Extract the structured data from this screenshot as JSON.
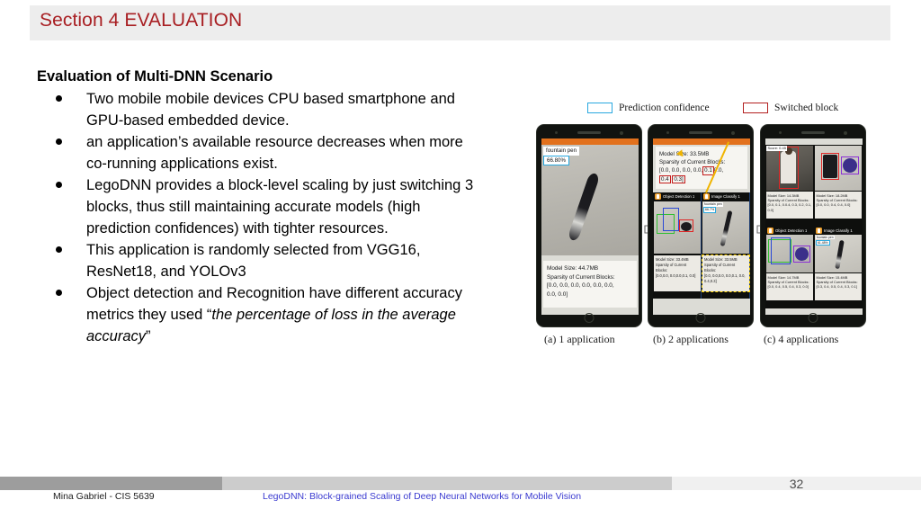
{
  "header": {
    "section_title": "Section 4 EVALUATION",
    "title_color": "#a81e22",
    "bar_color": "#ededed"
  },
  "content": {
    "heading": "Evaluation of Multi-DNN Scenario",
    "bullets": [
      {
        "text": "Two mobile mobile devices CPU based smartphone and GPU-based embedded device."
      },
      {
        "text": "an application’s available resource decreases when more co-running applications exist."
      },
      {
        "text": "LegoDNN provides a block-level scaling by just switching 3 blocks, thus still maintaining accurate models (high prediction confidences) with tighter resources."
      },
      {
        "text": "This application is randomly selected from VGG16, ResNet18, and YOLOv3"
      },
      {
        "lead": "Object detection and Recognition have different accuracy metrics they used “",
        "italic": "the percentage of loss in the average accuracy",
        "tail": "”"
      }
    ]
  },
  "figure": {
    "legend": [
      {
        "label": "Prediction confidence",
        "color": "#29a8df",
        "name": "prediction-confidence"
      },
      {
        "label": "Switched block",
        "color": "#b32020",
        "name": "switched-block"
      }
    ],
    "captions": [
      "(a) 1 application",
      "(b) 2 applications",
      "(c) 4 applications"
    ],
    "panel_a": {
      "class_label": "fountain pen",
      "confidence": "66.80%",
      "model_size": "Model Size: 44.7MB",
      "sparsity_heading": "Sparsity of Current Blocks:",
      "sparsity_line1": "[0.0, 0.0, 0.0, 0.0, 0.0, 0.0,",
      "sparsity_line2": "0.0, 0.0]"
    },
    "panel_b": {
      "model_size": "Model Size: 33.5MB",
      "sparsity_heading": "Sparsity of Current Blocks:",
      "sparsity_prefix": "[0.0, 0.0, 0.0, 0.0,",
      "sparsity_hl1": "0.1",
      "sparsity_mid": "0.0,",
      "sparsity_hl2": "0.4",
      "sparsity_hl3": "0.3]",
      "apps": [
        {
          "title": "Object Detection 1",
          "model_size": "Model Size: 33.4MB",
          "sparsity_heading": "Sparsity of Current Blocks:",
          "sparsity_values": "[0.0,0.0, 0.0,0.0,0.1, 0.0]"
        },
        {
          "title": "Image Classify 1",
          "model_size": "Model Size: 33.5MB",
          "sparsity_heading": "Sparsity of Current Blocks:",
          "sparsity_values": "[0.0, 0.0,0.0, 0.0,0.1, 0.0, 0.4,0.3]",
          "class_label": "fountain pen",
          "confidence": "66.7%"
        }
      ]
    },
    "panel_c": {
      "apps": [
        {
          "title": "",
          "score_tag": "Score: 0.45",
          "model_size": "Model Size: 14.3MB",
          "sparsity_heading": "Sparsity of Current Blocks:",
          "sparsity_values": "[0.0, 0.1, 0.0.4, 0.3, 0.2, 0.1, 0.0]"
        },
        {
          "title": "",
          "model_size": "Model Size: 18.2MB",
          "sparsity_heading": "Sparsity of Current Blocks:",
          "sparsity_values": "[0.0, 0.0, 0.4, 0.4, 0.0]"
        },
        {
          "title": "Object Detection 1",
          "model_size": "Model Size: 14.7MB",
          "sparsity_heading": "Sparsity of Current Blocks:",
          "sparsity_values": "[0.0, 0.4, 0.5, 0.4, 0.3, 0.0]"
        },
        {
          "title": "Image Classify 1",
          "model_size": "Model Size: 15.4MB",
          "sparsity_heading": "Sparsity of Current Blocks:",
          "sparsity_values": "[0.3, 0.4, 0.5, 0.4, 0.3, 0.1]",
          "class_label": "fountain pen",
          "confidence": "61.48%"
        }
      ]
    }
  },
  "footer": {
    "author": "Mina Gabriel - CIS  5639",
    "paper_link": "LegoDNN: Block-grained Scaling of Deep Neural Networks for Mobile Vision",
    "link_color": "#3a3ad0",
    "page_number": "32"
  }
}
